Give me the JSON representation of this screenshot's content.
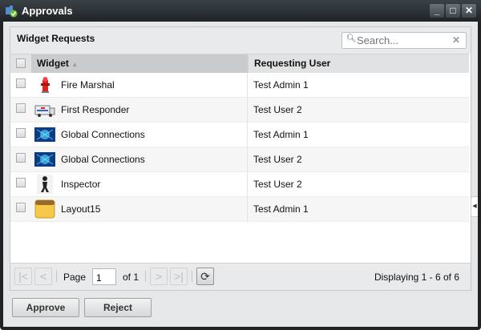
{
  "window": {
    "title": "Approvals",
    "icon": "puzzle-approve-icon"
  },
  "panel": {
    "title": "Widget Requests",
    "search": {
      "placeholder": "Search...",
      "value": ""
    }
  },
  "grid": {
    "columns": [
      {
        "label": "Widget",
        "sort": "ascending"
      },
      {
        "label": "Requesting User"
      }
    ],
    "rows": [
      {
        "widget": "Fire Marshal",
        "user": "Test Admin 1",
        "icon": "fire-hydrant-icon"
      },
      {
        "widget": "First Responder",
        "user": "Test User 2",
        "icon": "ambulance-icon"
      },
      {
        "widget": "Global Connections",
        "user": "Test Admin 1",
        "icon": "globe-network-icon"
      },
      {
        "widget": "Global Connections",
        "user": "Test User 2",
        "icon": "globe-network-icon"
      },
      {
        "widget": "Inspector",
        "user": "Test User 2",
        "icon": "inspector-figure-icon"
      },
      {
        "widget": "Layout15",
        "user": "Test Admin 1",
        "icon": "notepad-icon"
      }
    ]
  },
  "pager": {
    "page_label": "Page",
    "page": "1",
    "of_label": "of 1",
    "display": "Displaying 1 - 6 of 6"
  },
  "actions": {
    "approve": "Approve",
    "reject": "Reject"
  }
}
